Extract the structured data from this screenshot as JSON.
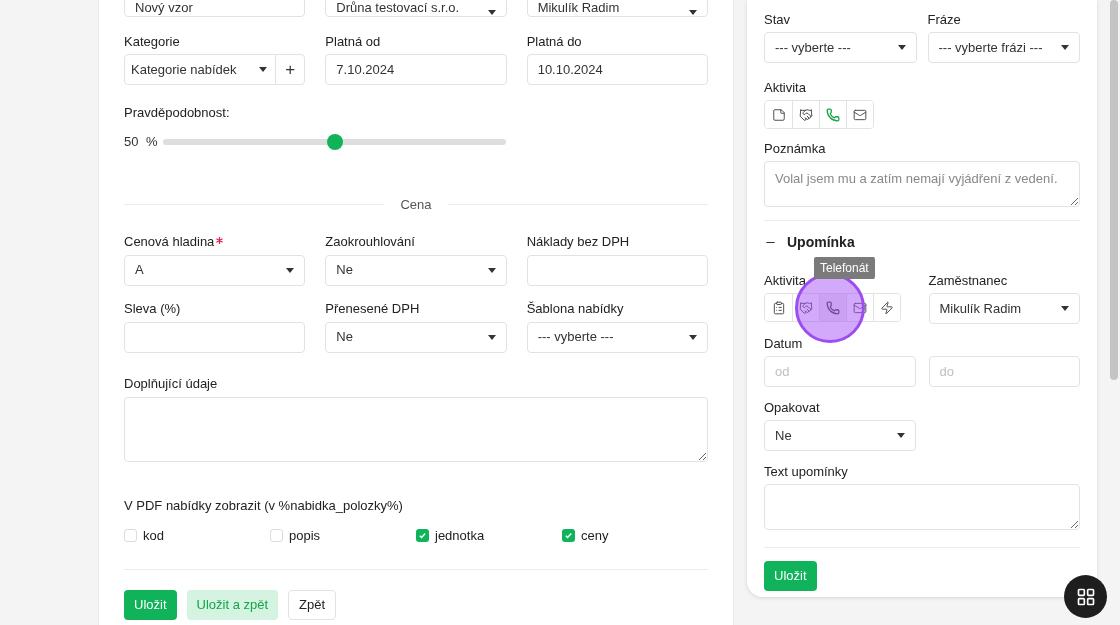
{
  "top_row": [
    {
      "kind": "input",
      "value": "Nový vzor"
    },
    {
      "kind": "select",
      "value": "Drůna testovací s.r.o."
    },
    {
      "kind": "select",
      "value": "Mikulík Radim"
    }
  ],
  "kategorie": {
    "label": "Kategorie",
    "value": "Kategorie nabídek",
    "add": "+"
  },
  "platna_od": {
    "label": "Platná od",
    "value": "7.10.2024"
  },
  "platna_do": {
    "label": "Platná do",
    "value": "10.10.2024"
  },
  "pravdepodobnost": {
    "label": "Pravděpodobnost:",
    "reading": "50",
    "unit": "%",
    "level": 0.5
  },
  "section_title": "Cena",
  "price_fields": [
    {
      "kind": "select",
      "label": "Cenová hladina",
      "required": true,
      "value": "A"
    },
    {
      "kind": "select",
      "label": "Zaokrouhlování",
      "required": false,
      "value": "Ne"
    },
    {
      "kind": "input",
      "label": "Náklady bez DPH",
      "required": false
    },
    {
      "kind": "input",
      "label": "Sleva (%)",
      "required": false
    },
    {
      "kind": "select",
      "label": "Přenesené DPH",
      "required": false,
      "value": "Ne"
    },
    {
      "kind": "select",
      "label": "Šablona nabídky",
      "required": false,
      "value": "--- vyberte ---"
    }
  ],
  "doplnujici": {
    "label": "Doplňující údaje"
  },
  "pdf": {
    "label": "V PDF nabídky zobrazit (v %nabidka_polozky%)",
    "options": [
      {
        "label": "kod",
        "checked": false
      },
      {
        "label": "popis",
        "checked": false
      },
      {
        "label": "jednotka",
        "checked": true
      },
      {
        "label": "ceny",
        "checked": true
      }
    ]
  },
  "buttons": [
    {
      "kind": "primary",
      "label": "Uložit"
    },
    {
      "kind": "soft",
      "label": "Uložit a zpět"
    },
    {
      "kind": "outline",
      "label": "Zpět"
    }
  ],
  "side": {
    "stav": {
      "label": "Stav",
      "value": "--- vyberte ---"
    },
    "fraze": {
      "label": "Fráze",
      "value": "--- vyberte frázi ---"
    },
    "aktivita": {
      "label": "Aktivita",
      "items": [
        {
          "kind": "note",
          "selected": false
        },
        {
          "kind": "meeting",
          "selected": false
        },
        {
          "kind": "phone",
          "selected": true
        },
        {
          "kind": "mail",
          "selected": false
        }
      ]
    },
    "poznamka": {
      "label": "Poznámka",
      "placeholder": "Volal jsem mu a zatím nemají vyjádření z vedení."
    },
    "upominka": {
      "title": "Upomínka",
      "expanded": true,
      "aktivita": {
        "label": "Aktivita",
        "tooltip": "Telefonát",
        "items": [
          {
            "kind": "clipboard",
            "selected": false
          },
          {
            "kind": "meeting",
            "selected": false
          },
          {
            "kind": "phone",
            "selected": true
          },
          {
            "kind": "mail",
            "selected": false
          },
          {
            "kind": "zap",
            "selected": false
          }
        ]
      },
      "zamestnanec": {
        "label": "Zaměstnanec",
        "value": "Mikulík Radim"
      },
      "datum": {
        "label": "Datum",
        "from_placeholder": "od",
        "to_placeholder": "do"
      },
      "opakovat": {
        "label": "Opakovat",
        "value": "Ne"
      },
      "text": {
        "label": "Text upomínky"
      },
      "save": "Uložit"
    }
  }
}
